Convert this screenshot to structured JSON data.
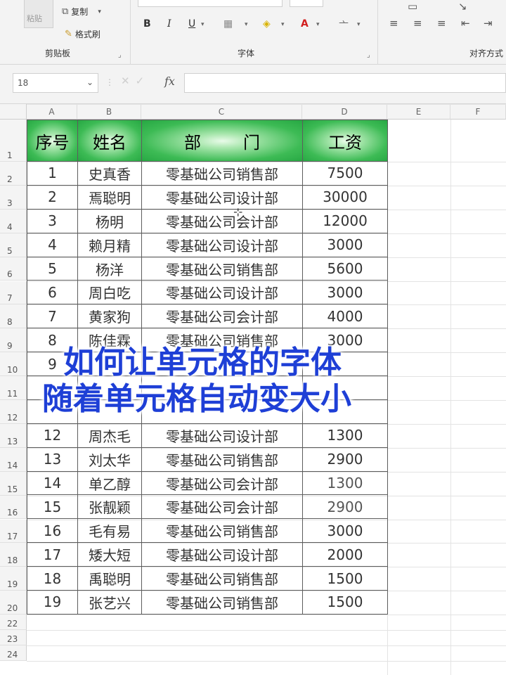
{
  "ribbon": {
    "clipboard": {
      "copy_label": "复制",
      "format_painter_label": "格式刷",
      "group_label": "剪贴板",
      "paste_label": "粘贴"
    },
    "font": {
      "group_label": "字体",
      "bold": "B",
      "italic": "I",
      "underline": "U"
    },
    "alignment": {
      "group_label": "对齐方式"
    }
  },
  "formula_bar": {
    "name_box": "18",
    "fx_label": "fx",
    "formula_value": ""
  },
  "columns": [
    "A",
    "B",
    "C",
    "D",
    "E",
    "F"
  ],
  "rows": [
    "1",
    "2",
    "3",
    "4",
    "5",
    "6",
    "7",
    "8",
    "9",
    "10",
    "11",
    "12",
    "13",
    "14",
    "15",
    "16",
    "17",
    "18",
    "19",
    "20",
    "21",
    "22",
    "23",
    "24"
  ],
  "table": {
    "headers": [
      "序号",
      "姓名",
      "部门",
      "工资"
    ],
    "rows": [
      [
        "1",
        "史真香",
        "零基础公司销售部",
        "7500"
      ],
      [
        "2",
        "焉聪明",
        "零基础公司设计部",
        "30000"
      ],
      [
        "3",
        "杨明",
        "零基础公司会计部",
        "12000"
      ],
      [
        "4",
        "赖月精",
        "零基础公司设计部",
        "3000"
      ],
      [
        "5",
        "杨洋",
        "零基础公司销售部",
        "5600"
      ],
      [
        "6",
        "周白吃",
        "零基础公司设计部",
        "3000"
      ],
      [
        "7",
        "黄家狗",
        "零基础公司会计部",
        "4000"
      ],
      [
        "8",
        "陈佳霖",
        "零基础公司销售部",
        "3000"
      ],
      [
        "9",
        "",
        "",
        ""
      ],
      [
        "",
        "",
        "",
        ""
      ],
      [
        "",
        "",
        "",
        ""
      ],
      [
        "12",
        "周杰毛",
        "零基础公司设计部",
        "1300"
      ],
      [
        "13",
        "刘太华",
        "零基础公司销售部",
        "2900"
      ],
      [
        "14",
        "单乙醇",
        "零基础公司会计部",
        "1300"
      ],
      [
        "15",
        "张靓颖",
        "零基础公司会计部",
        "2900"
      ],
      [
        "16",
        "毛有易",
        "零基础公司销售部",
        "3000"
      ],
      [
        "17",
        "矮大短",
        "零基础公司设计部",
        "2000"
      ],
      [
        "18",
        "禹聪明",
        "零基础公司销售部",
        "1500"
      ],
      [
        "19",
        "张艺兴",
        "零基础公司销售部",
        "1500"
      ]
    ]
  },
  "caption": {
    "line1": "如何让单元格的字体",
    "line2": "随着单元格自动变大小"
  },
  "colors": {
    "header_green": "#3dbb55",
    "caption_blue": "#1e3fd6"
  }
}
